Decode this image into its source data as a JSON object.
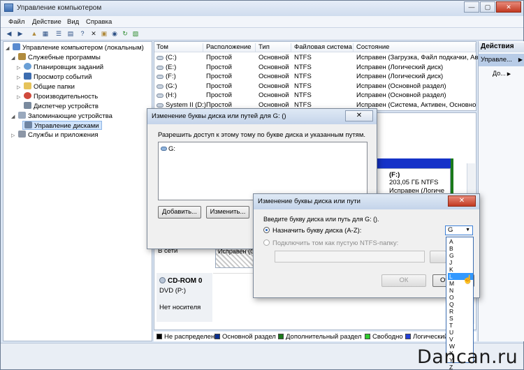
{
  "window": {
    "title": "Управление компьютером",
    "min": "—",
    "max": "▢",
    "close": "✕"
  },
  "menu": [
    "Файл",
    "Действие",
    "Вид",
    "Справка"
  ],
  "toolbar_icons": [
    "back-arrow-icon",
    "forward-arrow-icon",
    "up-folder-icon",
    "show-tree-icon",
    "list-icon",
    "properties-icon",
    "help-icon",
    "delete-icon",
    "folder-icon",
    "search-icon",
    "refresh-icon",
    "export-icon"
  ],
  "tree": [
    {
      "label": "Управление компьютером (локальным)",
      "level": 0,
      "icon": "computer-icon",
      "color": "#5a8bd0"
    },
    {
      "label": "Служебные программы",
      "level": 1,
      "icon": "tools-icon",
      "color": "#b08b3e"
    },
    {
      "label": "Планировщик заданий",
      "level": 2,
      "icon": "clock-icon",
      "color": "#6a9fd6"
    },
    {
      "label": "Просмотр событий",
      "level": 2,
      "icon": "event-icon",
      "color": "#3d6db0"
    },
    {
      "label": "Общие папки",
      "level": 2,
      "icon": "folder-icon",
      "color": "#e6c35a"
    },
    {
      "label": "Производительность",
      "level": 2,
      "icon": "perf-icon",
      "color": "#d04a3c"
    },
    {
      "label": "Диспетчер устройств",
      "level": 2,
      "icon": "device-icon",
      "color": "#7a8a9e"
    },
    {
      "label": "Запоминающие устройства",
      "level": 1,
      "icon": "storage-icon",
      "color": "#9aa9bd"
    },
    {
      "label": "Управление дисками",
      "level": 2,
      "icon": "disk-icon",
      "color": "#6f85a3"
    },
    {
      "label": "Службы и приложения",
      "level": 1,
      "icon": "services-icon",
      "color": "#8c96a6"
    }
  ],
  "columns": [
    "Том",
    "Расположение",
    "Тип",
    "Файловая система",
    "Состояние"
  ],
  "volumes": [
    [
      "(C:)",
      "Простой",
      "Основной",
      "NTFS",
      "Исправен (Загрузка, Файл подкачки, Ав"
    ],
    [
      "(E:)",
      "Простой",
      "Основной",
      "NTFS",
      "Исправен (Логический диск)"
    ],
    [
      "(F:)",
      "Простой",
      "Основной",
      "NTFS",
      "Исправен (Логический диск)"
    ],
    [
      "(G:)",
      "Простой",
      "Основной",
      "NTFS",
      "Исправен (Основной раздел)"
    ],
    [
      "(H:)",
      "Простой",
      "Основной",
      "NTFS",
      "Исправен (Основной раздел)"
    ],
    [
      "System II (D:)",
      "Простой",
      "Основной",
      "NTFS",
      "Исправен (Система, Активен, Основно"
    ]
  ],
  "actions": {
    "title": "Действия",
    "item": "Управле...",
    "sub": "До..."
  },
  "disk_map": {
    "f_label": "(F:)",
    "f_size": "203,05 ГБ NTFS",
    "f_state": "Исправен (Логиче",
    "online": "В сети",
    "g_state": "Исправен (О",
    "cdrom_title": "CD-ROM 0",
    "cdrom_drive": "DVD (P:)",
    "cdrom_media": "Нет носителя"
  },
  "legend": [
    {
      "label": "Не распределен",
      "color": "#000000"
    },
    {
      "label": "Основной раздел",
      "color": "#0b2f8f"
    },
    {
      "label": "Дополнительный раздел",
      "color": "#1b7a1b"
    },
    {
      "label": "Свободно",
      "color": "#2ecc2e"
    },
    {
      "label": "Логический",
      "color": "#2340d8"
    }
  ],
  "dialog1": {
    "title": "Изменение буквы диска или путей для G: ()",
    "description": "Разрешить доступ к этому тому по букве диска и указанным путям.",
    "path_item": "G:",
    "add": "Добавить...",
    "change": "Изменить..."
  },
  "dialog2": {
    "title": "Изменение буквы диска или пути",
    "prompt": "Введите букву диска или путь для G: ().",
    "opt_letter": "Назначить букву диска (A-Z):",
    "opt_folder": "Подключить том как пустую NTFS-папку:",
    "selected_letter": "G",
    "ok": "ОК",
    "cancel_partial": "От"
  },
  "letters": [
    "A",
    "B",
    "G",
    "J",
    "K",
    "L",
    "M",
    "N",
    "O",
    "Q",
    "R",
    "S",
    "T",
    "U",
    "V",
    "W",
    "X",
    "Y",
    "Z"
  ],
  "highlighted_letter": "L",
  "watermark": "Dancan.ru"
}
